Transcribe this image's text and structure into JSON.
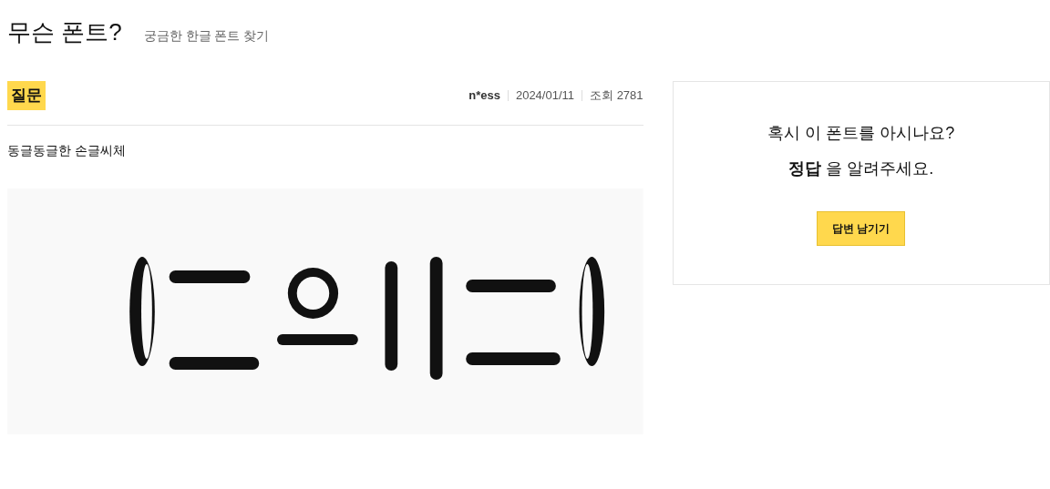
{
  "header": {
    "title": "무슨 폰트?",
    "subtitle": "궁금한 한글 폰트 찾기"
  },
  "post": {
    "badge": "질문",
    "author": "n*ess",
    "date": "2024/01/11",
    "views": "조회 2781",
    "body": "동글동글한 손글씨체"
  },
  "answer_card": {
    "question": "혹시 이 폰트를 아시나요?",
    "prompt": "**정답** 을 알려주세요.",
    "button": "답변 남기기"
  }
}
